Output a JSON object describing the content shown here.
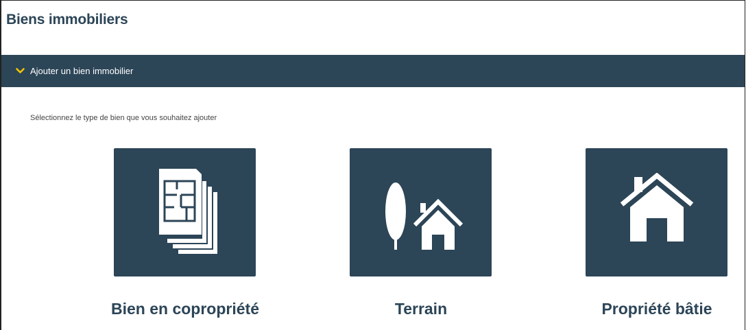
{
  "page": {
    "title": "Biens immobiliers"
  },
  "accordion": {
    "label": "Ajouter un bien immobilier",
    "chevron_icon": "chevron-down-icon",
    "chevron_color": "#f5c400"
  },
  "instruction": "Sélectionnez le type de bien que vous souhaitez ajouter",
  "property_types": [
    {
      "label": "Bien en copropriété",
      "icon": "floor-plan-documents-icon"
    },
    {
      "label": "Terrain",
      "icon": "tree-and-house-icon"
    },
    {
      "label": "Propriété bâtie",
      "icon": "house-icon"
    }
  ],
  "colors": {
    "primary": "#2c4557",
    "accent": "#f5c400",
    "background": "#ffffff"
  }
}
